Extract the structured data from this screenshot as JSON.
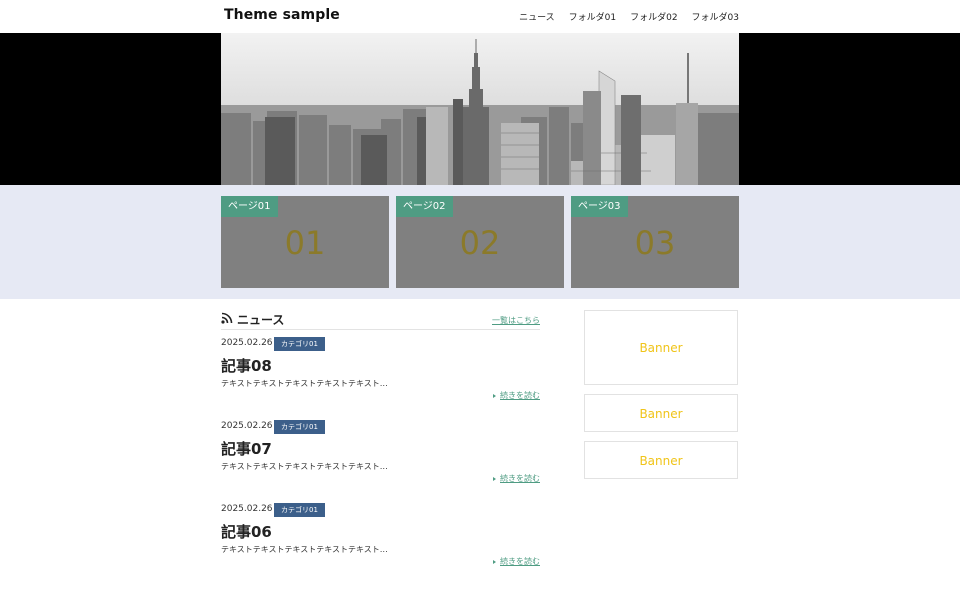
{
  "header": {
    "site_title": "Theme sample",
    "nav": [
      "ニュース",
      "フォルダ01",
      "フォルダ02",
      "フォルダ03"
    ]
  },
  "hero": {
    "image": "city-skyline"
  },
  "cards": [
    {
      "label": "ページ01",
      "number": "01"
    },
    {
      "label": "ページ02",
      "number": "02"
    },
    {
      "label": "ページ03",
      "number": "03"
    }
  ],
  "news": {
    "icon": "rss-icon",
    "title": "ニュース",
    "view_all": "一覧はこちら",
    "articles": [
      {
        "date": "2025.02.26",
        "category": "カテゴリ01",
        "title": "記事08",
        "excerpt": "テキストテキストテキストテキストテキスト…",
        "more": "続きを読む"
      },
      {
        "date": "2025.02.26",
        "category": "カテゴリ01",
        "title": "記事07",
        "excerpt": "テキストテキストテキストテキストテキスト…",
        "more": "続きを読む"
      },
      {
        "date": "2025.02.26",
        "category": "カテゴリ01",
        "title": "記事06",
        "excerpt": "テキストテキストテキストテキストテキスト…",
        "more": "続きを読む"
      }
    ]
  },
  "banners": [
    "Banner",
    "Banner",
    "Banner"
  ],
  "colors": {
    "accent_green": "#4f9c83",
    "badge_blue": "#3c5f8a",
    "banner_text": "#f0c419",
    "band_bg": "#e6e9f4"
  }
}
